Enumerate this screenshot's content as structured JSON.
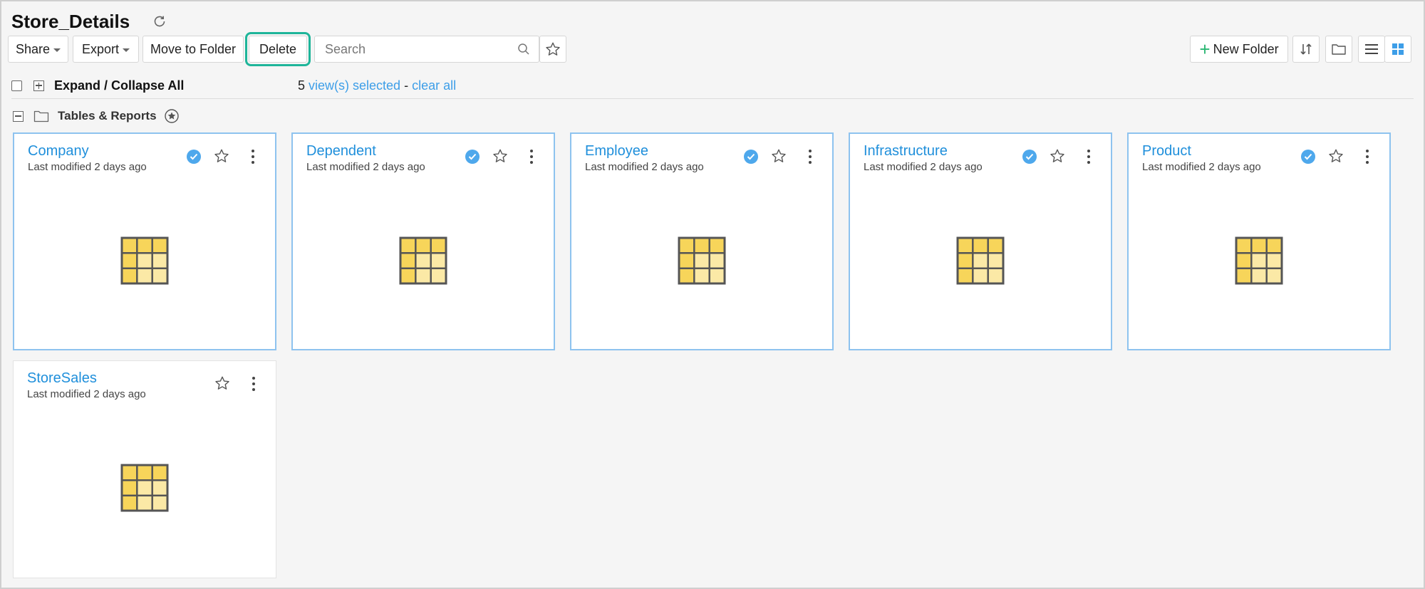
{
  "header": {
    "title": "Store_Details"
  },
  "toolbar": {
    "share_label": "Share",
    "export_label": "Export",
    "move_label": "Move to Folder",
    "delete_label": "Delete",
    "search_placeholder": "Search",
    "new_folder_label": "New Folder"
  },
  "selection": {
    "expand_label": "Expand / Collapse All",
    "count": "5",
    "views_selected": "view(s) selected",
    "separator": "-",
    "clear_all": "clear all"
  },
  "group": {
    "label": "Tables & Reports"
  },
  "cards": [
    {
      "title": "Company",
      "meta": "Last modified 2 days ago",
      "selected": true
    },
    {
      "title": "Dependent",
      "meta": "Last modified 2 days ago",
      "selected": true
    },
    {
      "title": "Employee",
      "meta": "Last modified 2 days ago",
      "selected": true
    },
    {
      "title": "Infrastructure",
      "meta": "Last modified 2 days ago",
      "selected": true
    },
    {
      "title": "Product",
      "meta": "Last modified 2 days ago",
      "selected": true
    },
    {
      "title": "StoreSales",
      "meta": "Last modified 2 days ago",
      "selected": false
    }
  ],
  "icons": {
    "refresh": "refresh-icon",
    "search": "search-icon",
    "favorites": "star-icon",
    "sort": "sort-icon",
    "folder": "folder-icon",
    "list_view": "list-view-icon",
    "grid_view": "grid-view-icon",
    "table": "table-icon"
  },
  "colors": {
    "accent": "#1f8fdb",
    "check": "#4ea8ec",
    "delete_highlight": "#1fb59a",
    "new_folder_plus": "#2bb673",
    "table_dark": "#f7d55a",
    "table_light": "#fbe9a6"
  }
}
